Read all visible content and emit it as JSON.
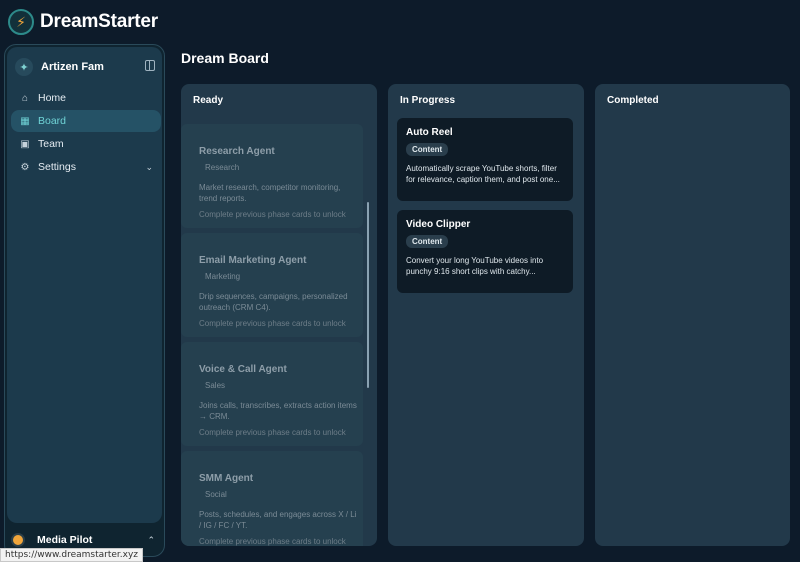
{
  "app": {
    "name": "DreamStarter",
    "logo_glyph": "⚡"
  },
  "sidebar": {
    "team": {
      "name": "Artizen Fam",
      "icon": "team-icon"
    },
    "items": [
      {
        "label": "Home",
        "icon": "home-icon",
        "glyph": "⌂"
      },
      {
        "label": "Board",
        "icon": "grid-icon",
        "glyph": "▦",
        "active": true
      },
      {
        "label": "Team",
        "icon": "briefcase-icon",
        "glyph": "▣"
      },
      {
        "label": "Settings",
        "icon": "gear-icon",
        "glyph": "⚙"
      }
    ],
    "footer": {
      "name": "Media Pilot"
    }
  },
  "page": {
    "title": "Dream Board"
  },
  "columns": {
    "ready": {
      "title": "Ready",
      "cards": [
        {
          "title": "Research Agent",
          "tag": "Research",
          "desc": "Market research, competitor monitoring, trend reports.",
          "note": "Complete previous phase cards to unlock"
        },
        {
          "title": "Email Marketing Agent",
          "tag": "Marketing",
          "desc": "Drip sequences, campaigns, personalized outreach (CRM C4).",
          "note": "Complete previous phase cards to unlock"
        },
        {
          "title": "Voice & Call Agent",
          "tag": "Sales",
          "desc": "Joins calls, transcribes, extracts action items → CRM.",
          "note": "Complete previous phase cards to unlock"
        },
        {
          "title": "SMM Agent",
          "tag": "Social",
          "desc": "Posts, schedules, and engages across X / Li / IG / FC / YT.",
          "note": "Complete previous phase cards to unlock"
        }
      ]
    },
    "in_progress": {
      "title": "In Progress",
      "cards": [
        {
          "title": "Auto Reel",
          "tag": "Content",
          "desc": "Automatically scrape YouTube shorts, filter for relevance, caption them, and post one..."
        },
        {
          "title": "Video Clipper",
          "tag": "Content",
          "desc": "Convert your long YouTube videos into punchy 9:16 short clips with catchy..."
        }
      ]
    },
    "completed": {
      "title": "Completed",
      "cards": []
    }
  },
  "status_bar": {
    "url": "https://www.dreamstarter.xyz"
  },
  "colors": {
    "background": "#0d1b2a",
    "sidebar": "#1c3a4c",
    "active_nav": "#255266",
    "accent": "#6fd3d6",
    "column": "#22394a",
    "card": "#0e1b26",
    "logo_bolt": "#f0a53b"
  }
}
